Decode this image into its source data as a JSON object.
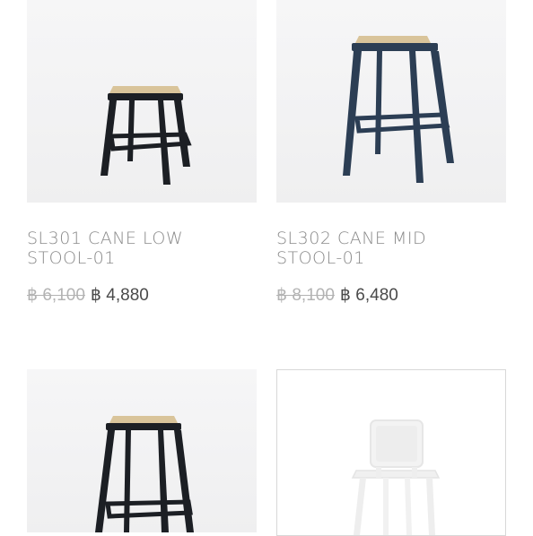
{
  "products": [
    {
      "title_line1": "SL301 CANE LOW",
      "title_line2": "STOOL-01",
      "price_old": "฿ 6,100",
      "price_new": "฿ 4,880"
    },
    {
      "title_line1": "SL302 CANE MID",
      "title_line2": "STOOL-01",
      "price_old": "฿ 8,100",
      "price_new": "฿ 6,480"
    },
    {},
    {}
  ],
  "colors": {
    "frame_black": "#1c1f24",
    "frame_navy": "#2c3e54",
    "cane": "#d9c49a",
    "title_gray": "#8a8a8a",
    "old_price": "#b3b3b3"
  }
}
